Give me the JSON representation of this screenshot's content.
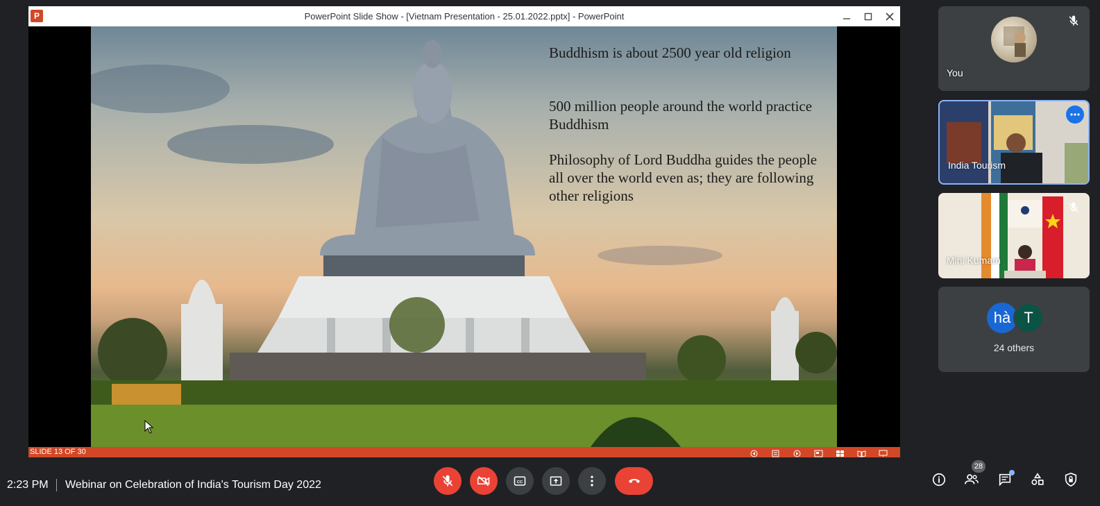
{
  "ppt": {
    "logo_letter": "P",
    "window_title": "PowerPoint Slide Show - [Vietnam Presentation - 25.01.2022.pptx] - PowerPoint",
    "slide_text_1": "Buddhism is about 2500 year old religion",
    "slide_text_2": "500 million people around the world practice Buddhism",
    "slide_text_3": "Philosophy of Lord Buddha guides the people all over the world even as; they are following other religions",
    "slide_counter": "SLIDE 13 OF 30",
    "status_color": "#d24726"
  },
  "participants": {
    "you": {
      "name": "You",
      "muted": true
    },
    "india": {
      "name": "India Tourism",
      "speaking": true
    },
    "mini": {
      "name": "Mini Kumam",
      "muted": true
    },
    "others": {
      "avatar1": "hà",
      "avatar2": "T",
      "label": "24 others"
    }
  },
  "meeting": {
    "time": "2:23 PM",
    "title": "Webinar on Celebration of India's Tourism Day 2022",
    "participant_count": "28"
  },
  "colors": {
    "accent": "#8ab4f8",
    "danger": "#ea4335",
    "surface": "#3c4043",
    "background": "#202124"
  }
}
